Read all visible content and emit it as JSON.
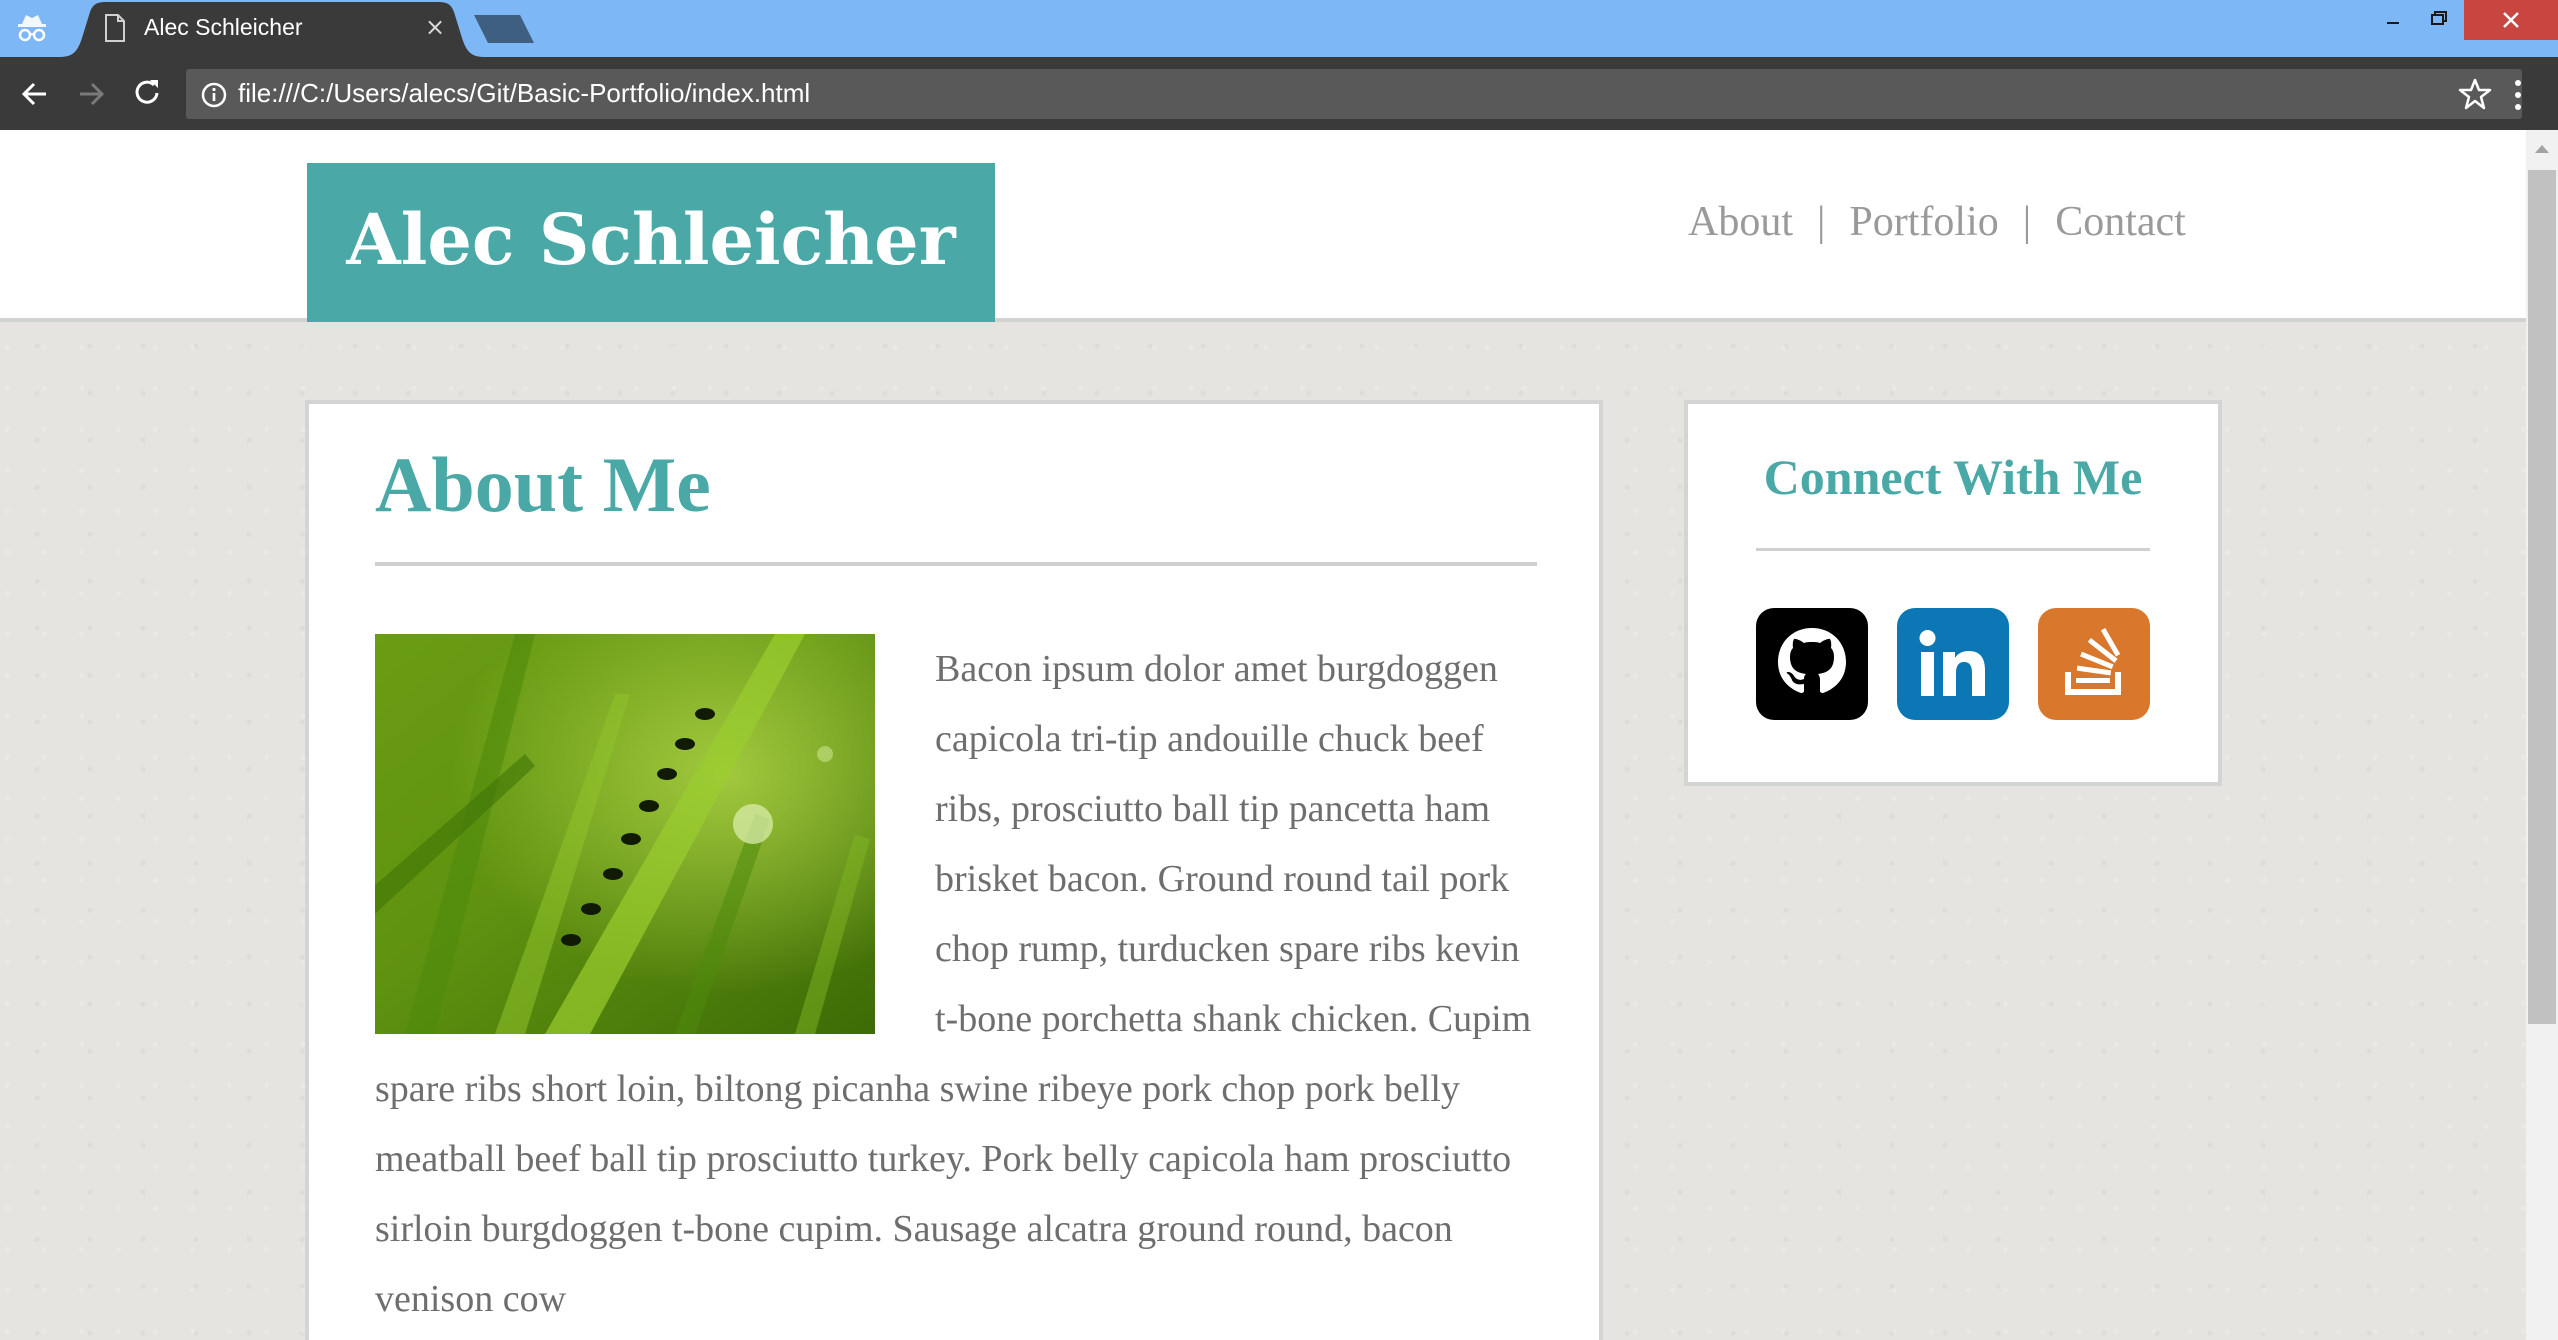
{
  "browser": {
    "tab_title": "Alec Schleicher",
    "tab_close": "×",
    "url": "file:///C:/Users/alecs/Git/Basic-Portfolio/index.html"
  },
  "header": {
    "logo": "Alec Schleicher",
    "nav": [
      {
        "label": "About"
      },
      {
        "label": "Portfolio"
      },
      {
        "label": "Contact"
      }
    ],
    "separator": "|"
  },
  "about": {
    "title": "About Me",
    "body": "Bacon ipsum dolor amet burgdoggen capicola tri-tip andouille chuck beef ribs, prosciutto ball tip pancetta ham brisket bacon. Ground round tail pork chop rump, turducken spare ribs kevin t-bone porchetta shank chicken. Cupim spare ribs short loin, biltong picanha swine ribeye pork chop pork belly meatball beef ball tip prosciutto turkey. Pork belly capicola ham prosciutto sirloin burgdoggen t-bone cupim. Sausage alcatra ground round, bacon venison cow"
  },
  "connect": {
    "title": "Connect With Me",
    "icons": [
      "github-icon",
      "linkedin-icon",
      "stack-overflow-icon"
    ]
  },
  "colors": {
    "accent": "#4aa9a6",
    "titlebar": "#7db7f5",
    "toolbar": "#3a3a3a",
    "github": "#000000",
    "linkedin": "#0b77b5",
    "stackoverflow": "#d9782d"
  }
}
